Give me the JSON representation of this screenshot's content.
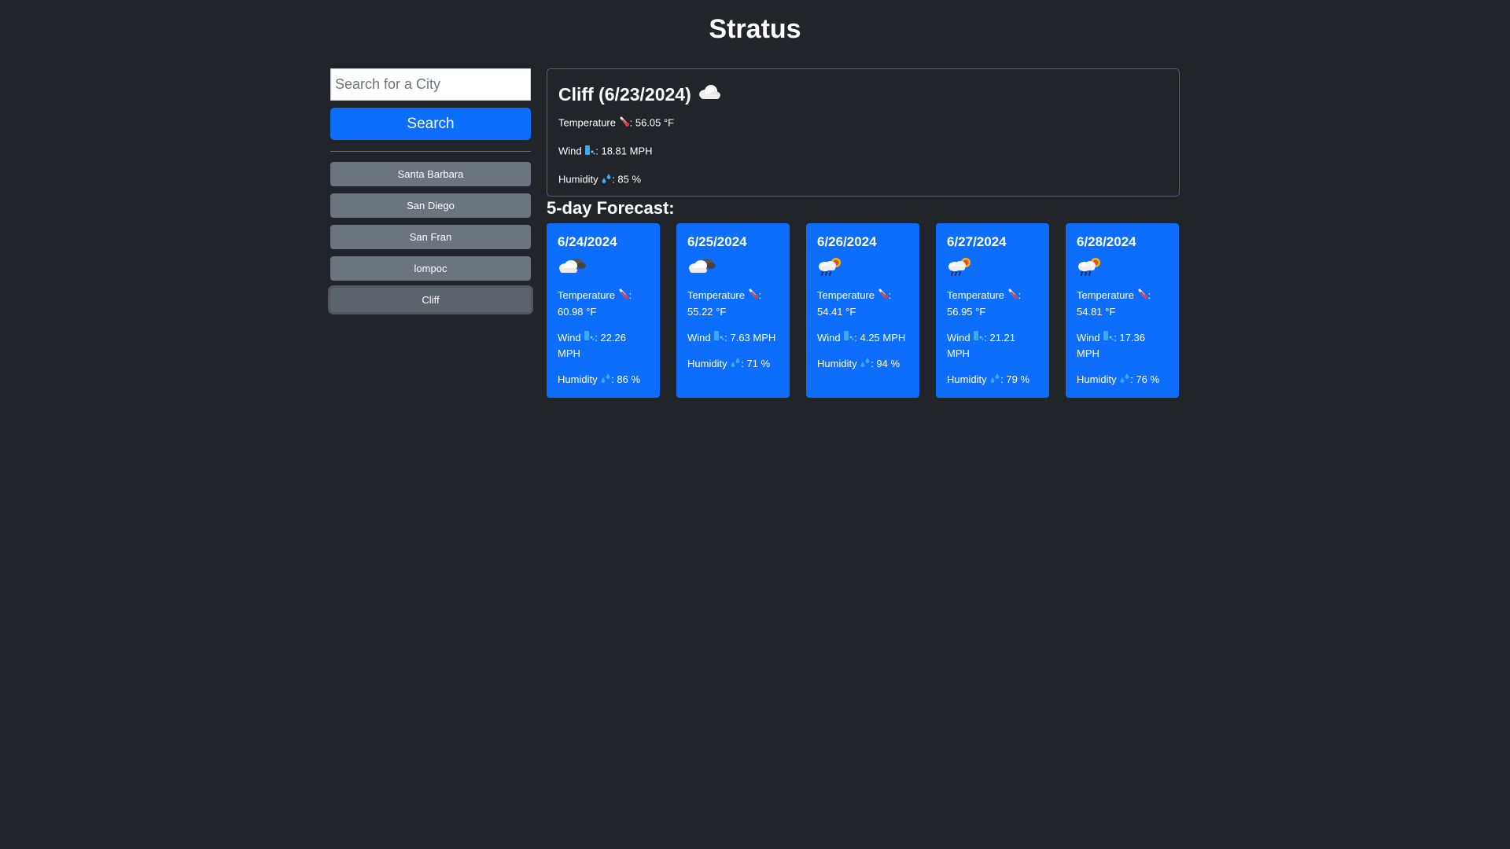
{
  "app": {
    "title": "Stratus"
  },
  "search": {
    "placeholder": "Search for a City",
    "value": "",
    "button_label": "Search"
  },
  "history": [
    {
      "label": "Santa Barbara",
      "active": false
    },
    {
      "label": "San Diego",
      "active": false
    },
    {
      "label": "San Fran",
      "active": false
    },
    {
      "label": "lompoc",
      "active": false
    },
    {
      "label": "Cliff",
      "active": true
    }
  ],
  "current": {
    "heading": "Cliff (6/23/2024)",
    "icon": "cloud-icon",
    "temperature_label": "Temperature",
    "temperature_value": ": 56.05 °F",
    "wind_label": "Wind",
    "wind_value": ": 18.81 MPH",
    "humidity_label": "Humidity",
    "humidity_value": ": 85 %"
  },
  "forecast": {
    "title": "5-day Forecast:",
    "days": [
      {
        "date": "6/24/2024",
        "icon": "dark-cloud-icon",
        "temperature_label": "Temperature",
        "temperature_value": ": 60.98 °F",
        "wind_label": "Wind",
        "wind_value": ": 22.26 MPH",
        "humidity_label": "Humidity",
        "humidity_value": ": 86 %"
      },
      {
        "date": "6/25/2024",
        "icon": "dark-cloud-icon",
        "temperature_label": "Temperature",
        "temperature_value": ": 55.22 °F",
        "wind_label": "Wind",
        "wind_value": ": 7.63 MPH",
        "humidity_label": "Humidity",
        "humidity_value": ": 71 %"
      },
      {
        "date": "6/26/2024",
        "icon": "sun-rain-cloud-icon",
        "temperature_label": "Temperature",
        "temperature_value": ": 54.41 °F",
        "wind_label": "Wind",
        "wind_value": ": 4.25 MPH",
        "humidity_label": "Humidity",
        "humidity_value": ": 94 %"
      },
      {
        "date": "6/27/2024",
        "icon": "sun-rain-cloud-icon",
        "temperature_label": "Temperature",
        "temperature_value": ": 56.95 °F",
        "wind_label": "Wind",
        "wind_value": ": 21.21 MPH",
        "humidity_label": "Humidity",
        "humidity_value": ": 79 %"
      },
      {
        "date": "6/28/2024",
        "icon": "sun-rain-cloud-icon",
        "temperature_label": "Temperature",
        "temperature_value": ": 54.81 °F",
        "wind_label": "Wind",
        "wind_value": ": 17.36 MPH",
        "humidity_label": "Humidity",
        "humidity_value": ": 76 %"
      }
    ]
  },
  "colors": {
    "background": "#212529",
    "primary": "#0d6efd",
    "secondary": "#6c757d"
  }
}
